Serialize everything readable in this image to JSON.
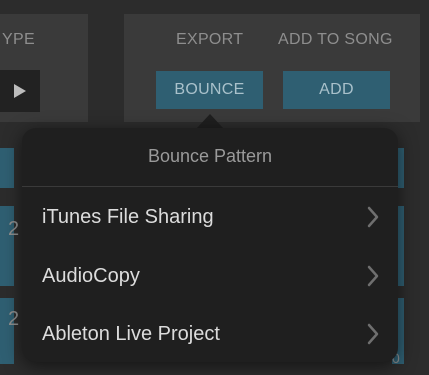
{
  "header": {
    "type_label_partial": "YPE",
    "export_label": "EXPORT",
    "add_to_song_label": "ADD TO SONG",
    "bounce_button": "BOUNCE",
    "add_button": "ADD"
  },
  "background": {
    "row_numbers": [
      "2",
      "2"
    ],
    "corner_text": "0"
  },
  "popover": {
    "title": "Bounce Pattern",
    "items": [
      {
        "label": "iTunes File Sharing",
        "icon": "chevron-right-icon"
      },
      {
        "label": "AudioCopy",
        "icon": "chevron-right-icon"
      },
      {
        "label": "Ableton Live Project",
        "icon": "chevron-right-icon"
      }
    ]
  },
  "colors": {
    "background": "#2c2c2c",
    "panel": "#3a3a3a",
    "accent_button": "#2f5f72",
    "popover_bg": "#1f1f1f"
  }
}
